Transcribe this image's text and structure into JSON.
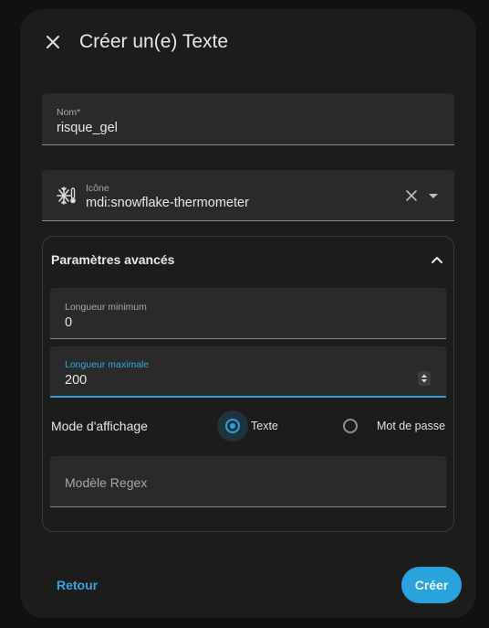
{
  "dialog": {
    "title": "Créer un(e) Texte",
    "close_icon": "close-icon"
  },
  "fields": {
    "name": {
      "label": "Nom*",
      "value": "risque_gel"
    },
    "icon": {
      "label": "Icône",
      "value": "mdi:snowflake-thermometer",
      "prefix_icon": "snowflake-thermometer-icon"
    }
  },
  "advanced": {
    "title": "Paramètres avancés",
    "expanded": true,
    "min_length": {
      "label": "Longueur minimum",
      "value": "0"
    },
    "max_length": {
      "label": "Longueur maximale",
      "value": "200"
    },
    "display_mode": {
      "label": "Mode d'affichage",
      "options": [
        "Texte",
        "Mot de passe"
      ],
      "selected": "Texte"
    },
    "regex": {
      "placeholder": "Modèle Regex",
      "value": ""
    }
  },
  "actions": {
    "back": "Retour",
    "create": "Créer"
  },
  "colors": {
    "accent": "#2aa3dd",
    "surface": "#1c1c1c",
    "field": "#2a2a2a"
  }
}
